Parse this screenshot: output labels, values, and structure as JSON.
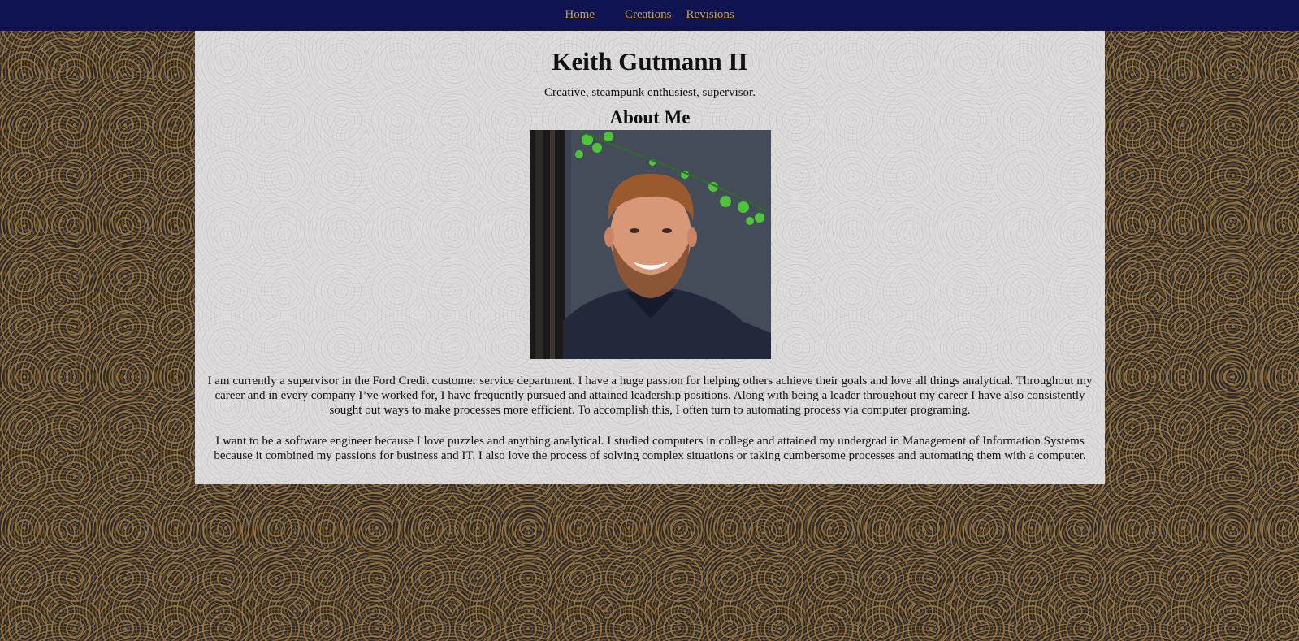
{
  "nav": {
    "home": "Home",
    "creations": "Creations",
    "revisions": "Revisions"
  },
  "profile": {
    "name": "Keith Gutmann II",
    "tagline": "Creative, steampunk enthusiest, supervisor.",
    "about_heading": "About Me",
    "paragraph1": "I am currently a supervisor in the Ford Credit customer service department. I have a huge passion for helping others achieve their goals and love all things analytical. Throughout my career and in every company I’ve worked for, I have frequently pursued and attained leadership positions. Along with being a leader throughout my career I have also consistently sought out ways to make processes more efficient. To accomplish this, I often turn to automating process via computer programing.",
    "paragraph2": "I want to be a software engineer because I love puzzles and anything analytical. I studied computers in college and attained my undergrad in Management of Information Systems because it combined my passions for business and IT. I also love the process of solving complex situations or taking cumbersome processes and automating them with a computer."
  },
  "colors": {
    "nav_bar": "#0f1450",
    "nav_link": "#c4a255",
    "content_panel": "#dedcdc"
  }
}
